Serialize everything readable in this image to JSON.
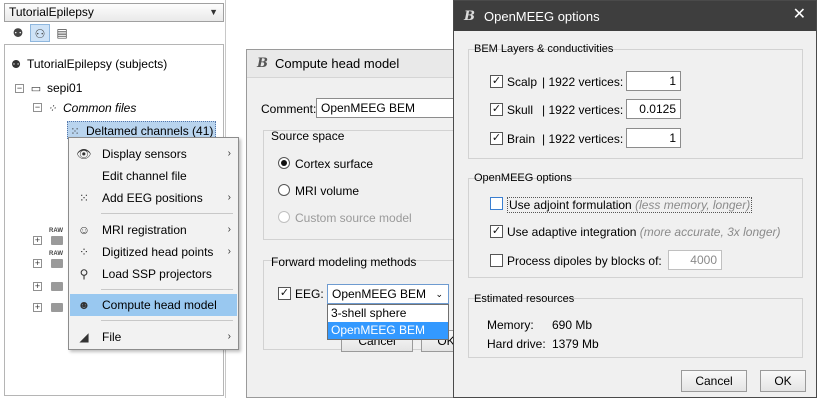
{
  "tree_panel": {
    "protocol": "TutorialEpilepsy",
    "toolbar_icons": [
      "subjects-view-icon",
      "functional-view-icon",
      "study-view-icon"
    ],
    "items": [
      {
        "label": "TutorialEpilepsy (subjects)"
      },
      {
        "label": "sepi01"
      },
      {
        "label": "Common files"
      },
      {
        "label": "Deltamed channels (41)"
      }
    ],
    "raw_label": "RAW"
  },
  "context_menu": {
    "items": [
      {
        "label": "Display sensors",
        "icon": "eye-icon",
        "submenu": true
      },
      {
        "label": "Edit channel file",
        "icon": "",
        "submenu": false
      },
      {
        "label": "Add EEG positions",
        "icon": "dots-icon",
        "submenu": true
      },
      {
        "label": "MRI registration",
        "icon": "head-icon",
        "submenu": true
      },
      {
        "label": "Digitized head points",
        "icon": "points-icon",
        "submenu": true
      },
      {
        "label": "Load SSP projectors",
        "icon": "projector-icon",
        "submenu": false
      },
      {
        "label": "Compute head model",
        "icon": "head-model-icon",
        "submenu": false,
        "highlighted": true
      },
      {
        "label": "File",
        "icon": "file-icon",
        "submenu": true
      }
    ]
  },
  "compute_dialog": {
    "title": "Compute head model",
    "logo": "B",
    "comment_label": "Comment:",
    "comment_value": "OpenMEEG BEM",
    "source_space_label": "Source space",
    "source_options": [
      {
        "label": "Cortex surface",
        "selected": true,
        "enabled": true
      },
      {
        "label": "MRI volume",
        "selected": false,
        "enabled": true
      },
      {
        "label": "Custom source model",
        "selected": false,
        "enabled": false
      }
    ],
    "forward_label": "Forward modeling methods",
    "eeg_label": "EEG:",
    "eeg_checked": true,
    "eeg_method": "OpenMEEG BEM",
    "eeg_options": [
      "3-shell sphere",
      "OpenMEEG BEM"
    ],
    "cancel_label": "Cancel",
    "ok_label": "OK"
  },
  "openmeeg_dialog": {
    "title": "OpenMEEG options",
    "logo": "B",
    "bem_group_label": "BEM Layers & conductivities",
    "layers": [
      {
        "name": "Scalp",
        "vertices": "| 1922 vertices:",
        "value": "1",
        "checked": true
      },
      {
        "name": "Skull",
        "vertices": "| 1922 vertices:",
        "value": "0.0125",
        "checked": true
      },
      {
        "name": "Brain",
        "vertices": "| 1922 vertices:",
        "value": "1",
        "checked": true
      }
    ],
    "options_group_label": "OpenMEEG options",
    "adjoint": {
      "label": "Use adjoint formulation",
      "hint": "(less memory, longer)",
      "checked": false
    },
    "adaptive": {
      "label": "Use adaptive integration",
      "hint": "(more accurate, 3x longer)",
      "checked": true
    },
    "blocks": {
      "label": "Process dipoles by blocks of:",
      "value": "4000",
      "checked": false
    },
    "resources_label": "Estimated resources",
    "memory_label": "Memory:",
    "memory_value": "690 Mb",
    "disk_label": "Hard drive:",
    "disk_value": "1379 Mb",
    "cancel_label": "Cancel",
    "ok_label": "OK"
  }
}
